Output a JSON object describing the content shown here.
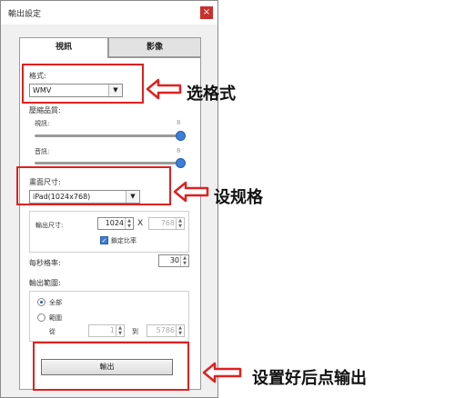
{
  "dialog": {
    "title": "輸出設定",
    "close_glyph": "×",
    "tabs": [
      {
        "label": "視訊"
      },
      {
        "label": "影像"
      }
    ]
  },
  "format": {
    "label": "格式:",
    "selected": "WMV"
  },
  "quality": {
    "label": "壓縮品質:",
    "video_label": "視訊:",
    "video_value": "8",
    "video_level_fraction": 1.0,
    "audio_label": "音訊:",
    "audio_value": "8",
    "audio_level_fraction": 1.0
  },
  "screen_size": {
    "label": "畫面尺寸:",
    "selected": "iPad(1024x768)",
    "output_size_label": "輸出尺寸:",
    "width": "1024",
    "times": "X",
    "height": "768",
    "lock_ratio_label": "鎖定比率",
    "lock_ratio_checked": true
  },
  "frame_rate": {
    "label": "每秒格率:",
    "value": "30"
  },
  "range": {
    "label": "輸出範圍:",
    "all_label": "全部",
    "range_label": "範圍",
    "from_label": "從",
    "from_value": "1",
    "to_label": "到",
    "to_value": "5786"
  },
  "export_button": "輸出",
  "annotations": {
    "format": "选格式",
    "size": "设规格",
    "export": "设置好后点输出"
  },
  "colors": {
    "annotation_red": "#e02020",
    "accent_blue": "#3d7fd6"
  }
}
